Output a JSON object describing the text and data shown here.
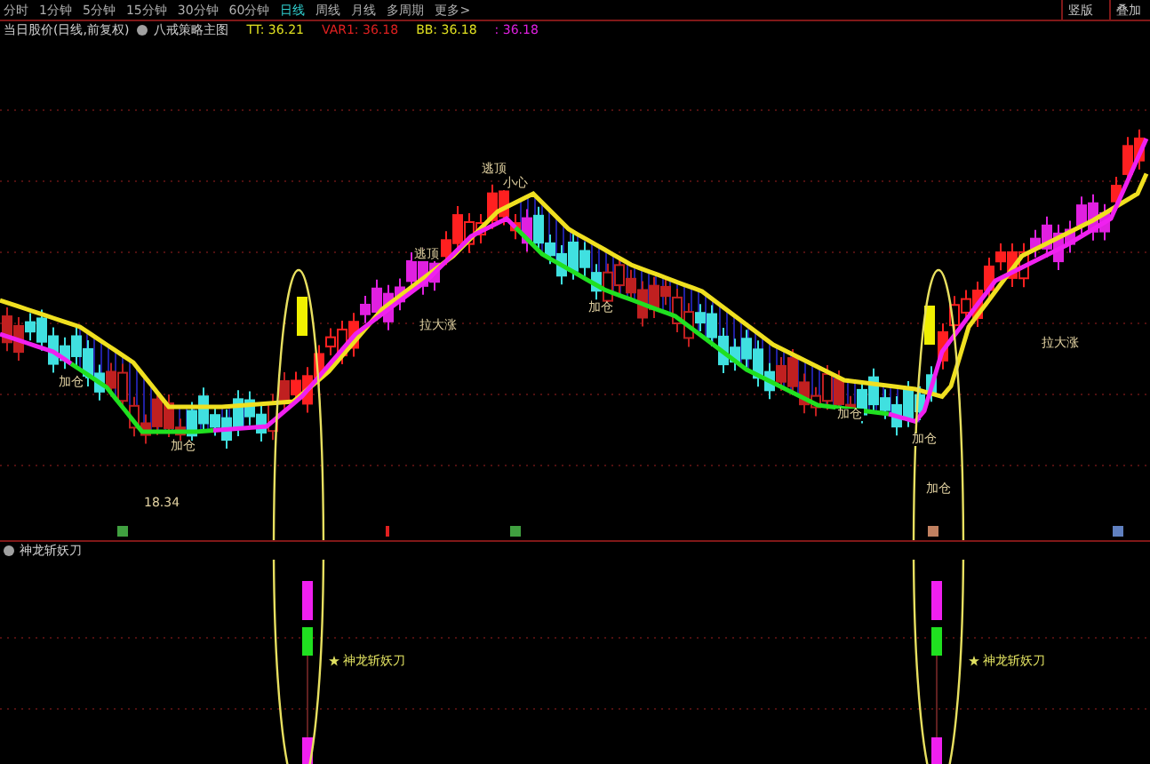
{
  "period_tabs": [
    {
      "label": "分时",
      "selected": false
    },
    {
      "label": "1分钟",
      "selected": false
    },
    {
      "label": "5分钟",
      "selected": false
    },
    {
      "label": "15分钟",
      "selected": false
    },
    {
      "label": "30分钟",
      "selected": false
    },
    {
      "label": "60分钟",
      "selected": false
    },
    {
      "label": "日线",
      "selected": true
    },
    {
      "label": "周线",
      "selected": false
    },
    {
      "label": "月线",
      "selected": false
    },
    {
      "label": "多周期",
      "selected": false
    },
    {
      "label": "更多>",
      "selected": false
    }
  ],
  "right_buttons": [
    "竖版",
    "叠加"
  ],
  "legend": {
    "title": "当日股价(日线,前复权)",
    "indicator": "八戒策略主图",
    "values": [
      {
        "label": "TT: 36.21",
        "color": "#e0e020"
      },
      {
        "label": "VAR1: 36.18",
        "color": "#e02020"
      },
      {
        "label": "BB: 36.18",
        "color": "#e0e020"
      },
      {
        "label": ": 36.18",
        "color": "#e020e0"
      }
    ]
  },
  "main_chart": {
    "annotations": [
      "加仓",
      "加仓",
      "18.34",
      "逃顶",
      "小心",
      "拉大涨",
      "逃顶",
      "加仓",
      "加仓",
      "加仓",
      "加仓",
      "拉大涨"
    ]
  },
  "sub_chart": {
    "title": "神龙斩妖刀",
    "signals": [
      "神龙斩妖刀",
      "神龙斩妖刀"
    ]
  }
}
